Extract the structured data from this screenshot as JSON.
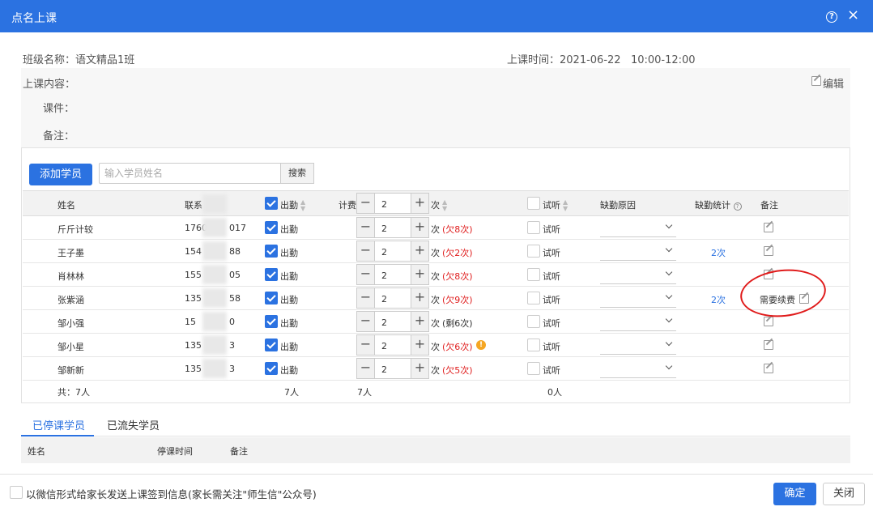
{
  "dialog": {
    "title": "点名上课",
    "help_icon": "?",
    "close_icon": "×"
  },
  "info": {
    "class_label": "班级名称：语文精品1班",
    "time_label": "上课时间：2021-06-22   10:00-12:00",
    "content_label": "上课内容：",
    "edit_label": "编辑",
    "courseware_label": "课件：",
    "remark_label": "备注："
  },
  "toolbar": {
    "add_button": "添加学员",
    "search_placeholder": "输入学员姓名",
    "search_button": "搜索"
  },
  "table": {
    "headers": {
      "name": "姓名",
      "contact": "联系",
      "attend": "出勤",
      "charge": "计费",
      "charge_stepper_value": "2",
      "times": "次",
      "trial": "试听",
      "absence_reason": "缺勤原因",
      "absence_stats": "缺勤统计",
      "remark": "备注"
    },
    "rows": [
      {
        "name": "斤斤计较",
        "phone_a": "1760",
        "phone_b": "017",
        "attend": "出勤",
        "count": "2",
        "times": "次",
        "balance": "(欠8次)",
        "balance_red": true,
        "warn": false,
        "trial": "试听",
        "stats": "",
        "remark": ""
      },
      {
        "name": "王子墨",
        "phone_a": "154",
        "phone_b": "88",
        "attend": "出勤",
        "count": "2",
        "times": "次",
        "balance": "(欠2次)",
        "balance_red": true,
        "warn": false,
        "trial": "试听",
        "stats": "2次",
        "remark": ""
      },
      {
        "name": "肖林林",
        "phone_a": "155",
        "phone_b": "05",
        "attend": "出勤",
        "count": "2",
        "times": "次",
        "balance": "(欠8次)",
        "balance_red": true,
        "warn": false,
        "trial": "试听",
        "stats": "",
        "remark": ""
      },
      {
        "name": "张紫涵",
        "phone_a": "135",
        "phone_b": "58",
        "attend": "出勤",
        "count": "2",
        "times": "次",
        "balance": "(欠9次)",
        "balance_red": true,
        "warn": false,
        "trial": "试听",
        "stats": "2次",
        "remark": "需要续费"
      },
      {
        "name": "邹小强",
        "phone_a": "15",
        "phone_b": "0",
        "attend": "出勤",
        "count": "2",
        "times": "次",
        "balance": "(剩6次)",
        "balance_red": false,
        "warn": false,
        "trial": "试听",
        "stats": "",
        "remark": ""
      },
      {
        "name": "邹小星",
        "phone_a": "135",
        "phone_b": "3",
        "attend": "出勤",
        "count": "2",
        "times": "次",
        "balance": "(欠6次)",
        "balance_red": true,
        "warn": true,
        "trial": "试听",
        "stats": "",
        "remark": ""
      },
      {
        "name": "邹新新",
        "phone_a": "135",
        "phone_b": "3",
        "attend": "出勤",
        "count": "2",
        "times": "次",
        "balance": "(欠5次)",
        "balance_red": true,
        "warn": false,
        "trial": "试听",
        "stats": "",
        "remark": ""
      }
    ],
    "summary": {
      "total": "共：7人",
      "attend": "7人",
      "charge": "7人",
      "trial": "0人"
    }
  },
  "tabs": {
    "stopped": "已停课学员",
    "lost": "已流失学员"
  },
  "sub_table": {
    "name": "姓名",
    "stop_time": "停课时间",
    "remark": "备注"
  },
  "footer": {
    "wechat_notice": "以微信形式给家长发送上课签到信息(家长需关注\"师生信\"公众号)",
    "confirm": "确定",
    "close": "关闭"
  },
  "colors": {
    "primary": "#2b72e1",
    "danger": "#e02020",
    "warning": "#f5a623"
  }
}
